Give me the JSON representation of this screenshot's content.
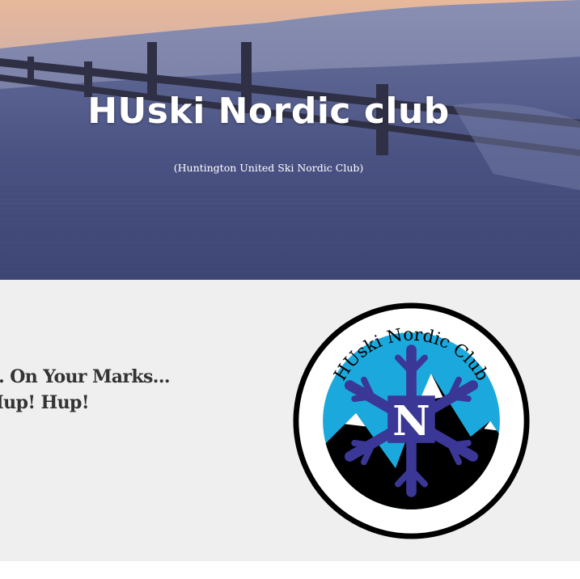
{
  "hero": {
    "title": "HUski Nordic club",
    "subtitle": "(Huntington United Ski Nordic Club)"
  },
  "section": {
    "tagline_line1": "... On Your Marks...",
    "tagline_line2": "Hup! Hup!"
  },
  "logo": {
    "arc_text": "HUski Nordic Club",
    "center_letter": "N",
    "icon": "snowflake-icon"
  },
  "colors": {
    "section_bg": "#efefef",
    "logo_sky": "#1ba9dd",
    "logo_snowflake": "#3a3796",
    "text_dark": "#333333"
  }
}
